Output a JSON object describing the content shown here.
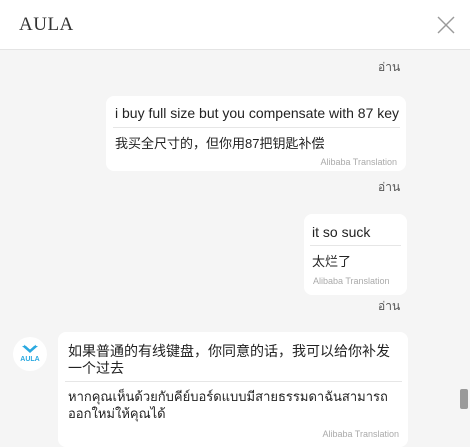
{
  "header": {
    "title": "AULA"
  },
  "messages": [
    {
      "read": "อ่าน"
    },
    {
      "text": "i buy full size but you compensate with 87 key",
      "translation": "我买全尺寸的，但你用87把钥匙补偿",
      "source": "Alibaba Translation",
      "read": "อ่าน"
    },
    {
      "text": "it so suck",
      "translation": "太烂了",
      "source": "Alibaba Translation",
      "read": "อ่าน"
    },
    {
      "text_line1": "如果普通的有线键盘，你同意的话，我可以给你补发",
      "text_line2": "一个过去",
      "translation_line1": "หากคุณเห็นด้วยกับคีย์บอร์ดแบบมีสายธรรมดาฉันสามารถ",
      "translation_line2": "ออกใหม่ให้คุณได้",
      "source": "Alibaba Translation",
      "avatar_text": "AULA"
    }
  ],
  "colors": {
    "accent": "#2aa9e0",
    "bubble": "#ffffff",
    "background": "#f5f5f5"
  }
}
